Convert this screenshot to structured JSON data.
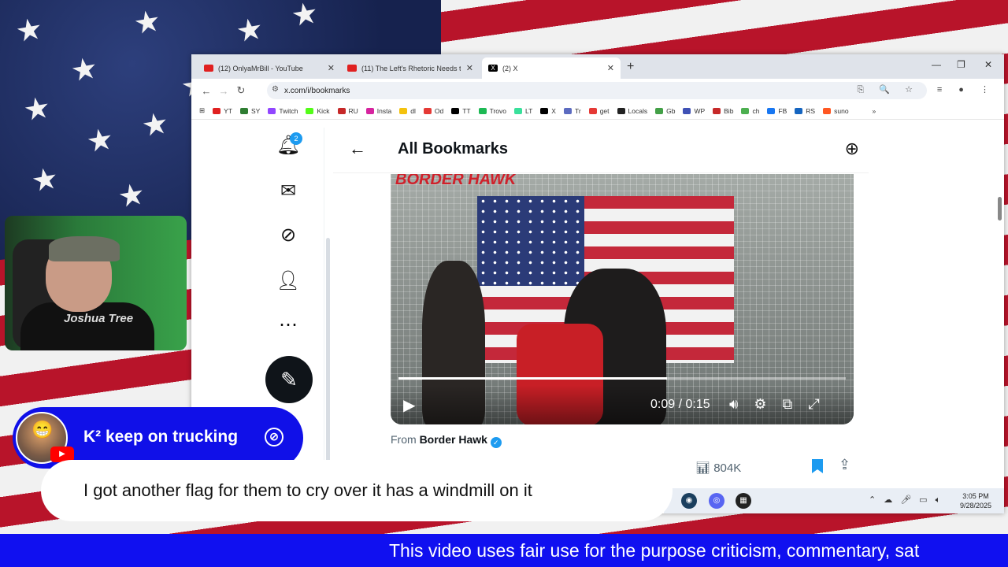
{
  "browser": {
    "tabs": [
      {
        "label": "(12) OnlyaMrBill - YouTube",
        "icon": "youtube-icon"
      },
      {
        "label": "(11) The Left's Rhetoric Needs t",
        "icon": "youtube-icon"
      },
      {
        "label": "(2) X",
        "icon": "x-icon"
      }
    ],
    "url": "x.com/i/bookmarks",
    "bookmarks": [
      "YT",
      "SY",
      "Twitch",
      "Kick",
      "RU",
      "Insta",
      "dl",
      "Od",
      "TT",
      "Trovo",
      "LT",
      "X",
      "Tr",
      "get",
      "Locals",
      "Gb",
      "WP",
      "Bib",
      "ch",
      "FB",
      "RS",
      "suno"
    ]
  },
  "x": {
    "notification_count": "2",
    "page_title": "All Bookmarks",
    "video_brand": "BORDER HAWK",
    "video_time": "0:09 / 0:15",
    "video_progress": 0.6,
    "from_prefix": "From",
    "from_source": "Border Hawk",
    "views": "804K"
  },
  "taskbar": {
    "time": "3:05 PM",
    "date": "9/28/2025"
  },
  "webcam": {
    "shirt_text": "Joshua Tree"
  },
  "chat": {
    "username": "K² keep on trucking",
    "message": "I got another flag for them to cry over it has a windmill on it"
  },
  "ticker": {
    "text": "This video uses fair use for the purpose criticism, commentary, sat"
  },
  "colors": {
    "chat_blue": "#1010e8",
    "x_blue": "#1d9bf0"
  }
}
